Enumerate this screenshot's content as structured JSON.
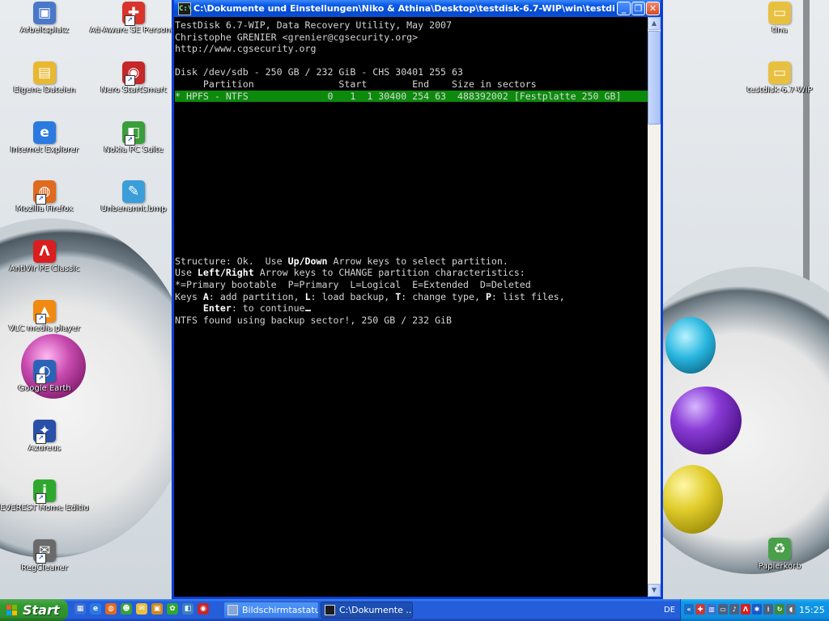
{
  "desktop": {
    "icons_left": [
      {
        "name": "arbeitsplatz",
        "label": "Arbeitsplatz",
        "glyph": "▣",
        "color": "#4a78c8",
        "shortcut": false
      },
      {
        "name": "ad-aware",
        "label": "Ad-Aware SE Personal",
        "glyph": "✚",
        "color": "#d8342c",
        "shortcut": true
      },
      {
        "name": "eigene-dateien",
        "label": "Eigene Dateien",
        "glyph": "▤",
        "color": "#e8b830",
        "shortcut": false
      },
      {
        "name": "nero-startsmart",
        "label": "Nero StartSmart",
        "glyph": "◉",
        "color": "#c42828",
        "shortcut": true
      },
      {
        "name": "internet-explorer",
        "label": "Internet Explorer",
        "glyph": "e",
        "color": "#2b7ae0",
        "shortcut": false
      },
      {
        "name": "nokia-pc-suite",
        "label": "Nokia PC Suite",
        "glyph": "◧",
        "color": "#3a9e3a",
        "shortcut": true
      },
      {
        "name": "mozilla-firefox",
        "label": "Mozilla Firefox",
        "glyph": "◍",
        "color": "#e06a1e",
        "shortcut": true
      },
      {
        "name": "unbenannt-bmp",
        "label": "Unbenannt.bmp",
        "glyph": "✎",
        "color": "#3b9ed8",
        "shortcut": false
      },
      {
        "name": "antivir",
        "label": "AntiVir PE Classic",
        "glyph": "Λ",
        "color": "#d81e1e",
        "shortcut": false
      },
      {
        "name": "vlc",
        "label": "VLC media player",
        "glyph": "▲",
        "color": "#f08a10",
        "shortcut": true
      },
      {
        "name": "google-earth",
        "label": "Google Earth",
        "glyph": "◐",
        "color": "#2a64b8",
        "shortcut": true
      },
      {
        "name": "azureus",
        "label": "Azureus",
        "glyph": "✦",
        "color": "#2850a8",
        "shortcut": true
      },
      {
        "name": "everest",
        "label": "EVEREST Home Edition",
        "glyph": "i",
        "color": "#2ea82e",
        "shortcut": true
      },
      {
        "name": "regcleaner",
        "label": "RegCleaner",
        "glyph": "✉",
        "color": "#6a6a6a",
        "shortcut": true
      }
    ],
    "icons_right": [
      {
        "name": "tina",
        "label": "tina",
        "glyph": "▭",
        "color": "#e8c040",
        "shortcut": false
      },
      {
        "name": "testdisk-folder",
        "label": "testdisk-6.7-WIP",
        "glyph": "▭",
        "color": "#e8c040",
        "shortcut": false
      },
      {
        "name": "papierkorb",
        "label": "Papierkorb",
        "glyph": "♻",
        "color": "#4aa04a",
        "shortcut": false
      }
    ]
  },
  "window": {
    "title": "C:\\Dokumente und Einstellungen\\Niko & Athina\\Desktop\\testdisk-6.7-WIP\\win\\testdisk_win.exe",
    "icon_glyph": "C:\\",
    "minimize": "_",
    "restore": "❐",
    "close": "✕",
    "scroll_up": "▲",
    "scroll_down": "▼",
    "scroll_position_fraction": 0.0,
    "scroll_visible_fraction": 0.17
  },
  "terminal": {
    "header1": "TestDisk 6.7-WIP, Data Recovery Utility, May 2007",
    "header2": "Christophe GRENIER <grenier@cgsecurity.org>",
    "header3": "http://www.cgsecurity.org",
    "disk_line": "Disk /dev/sdb - 250 GB / 232 GiB - CHS 30401 255 63",
    "columns": "     Partition               Start        End    Size in sectors",
    "partition_row": "* HPFS - NTFS              0   1  1 30400 254 63  488392002 [Festplatte 250 GB]",
    "structure_a": "Structure: Ok.  Use ",
    "structure_key": "Up/Down",
    "structure_b": " Arrow keys to select partition.",
    "use_a": "Use ",
    "use_key": "Left/Right",
    "use_b": " Arrow keys to CHANGE partition characteristics:",
    "legend": "*=Primary bootable  P=Primary  L=Logical  E=Extended  D=Deleted",
    "keys_a": "Keys ",
    "keys_A": "A",
    "keys_b": ": add partition, ",
    "keys_L": "L",
    "keys_c": ": load backup, ",
    "keys_T": "T",
    "keys_d": ": change type, ",
    "keys_P": "P",
    "keys_e": ": list files,",
    "enter_indent": "     ",
    "enter_key": "Enter",
    "enter_text": ": to continue",
    "ntfs_line": "NTFS found using backup sector!, 250 GB / 232 GiB"
  },
  "taskbar": {
    "start_label": "Start",
    "quick_launch": [
      {
        "name": "show-desktop",
        "glyph": "▦",
        "color": "#3a6fd0"
      },
      {
        "name": "ie-quick",
        "glyph": "e",
        "color": "#2b7ae0"
      },
      {
        "name": "firefox-quick",
        "glyph": "◍",
        "color": "#e06a1e"
      },
      {
        "name": "messenger-quick",
        "glyph": "☻",
        "color": "#3aa03a"
      },
      {
        "name": "chat-quick",
        "glyph": "✉",
        "color": "#e8c040"
      },
      {
        "name": "photo-quick",
        "glyph": "▣",
        "color": "#d08a20"
      },
      {
        "name": "plugin-quick",
        "glyph": "✿",
        "color": "#2ea82e"
      },
      {
        "name": "media-quick",
        "glyph": "◧",
        "color": "#3a80c0"
      },
      {
        "name": "nero-quick",
        "glyph": "◉",
        "color": "#c42828"
      }
    ],
    "tasks": [
      {
        "name": "task-bildschirmtastatur",
        "label": "Bildschirmtastatur",
        "state": "inactive"
      },
      {
        "name": "task-testdisk",
        "label": "C:\\Dokumente ...",
        "state": "active"
      }
    ],
    "language": "DE",
    "clock": "15:25",
    "tray_icons": [
      {
        "name": "tray-arrow",
        "glyph": "«",
        "color": "#1a6ec8"
      },
      {
        "name": "tray-shield",
        "glyph": "✚",
        "color": "#c83a3a"
      },
      {
        "name": "tray-network",
        "glyph": "▥",
        "color": "#3a6fd0"
      },
      {
        "name": "tray-monitor",
        "glyph": "▭",
        "color": "#4a6080"
      },
      {
        "name": "tray-volume",
        "glyph": "♪",
        "color": "#4a6080"
      },
      {
        "name": "tray-antivir",
        "glyph": "Λ",
        "color": "#d81e1e"
      },
      {
        "name": "tray-bluetooth",
        "glyph": "✱",
        "color": "#1a58c8"
      },
      {
        "name": "tray-dots",
        "glyph": "⁞",
        "color": "#4a6080"
      },
      {
        "name": "tray-sync",
        "glyph": "↻",
        "color": "#3a8a3a"
      },
      {
        "name": "tray-speaker",
        "glyph": "◖",
        "color": "#5a6a80"
      }
    ]
  }
}
